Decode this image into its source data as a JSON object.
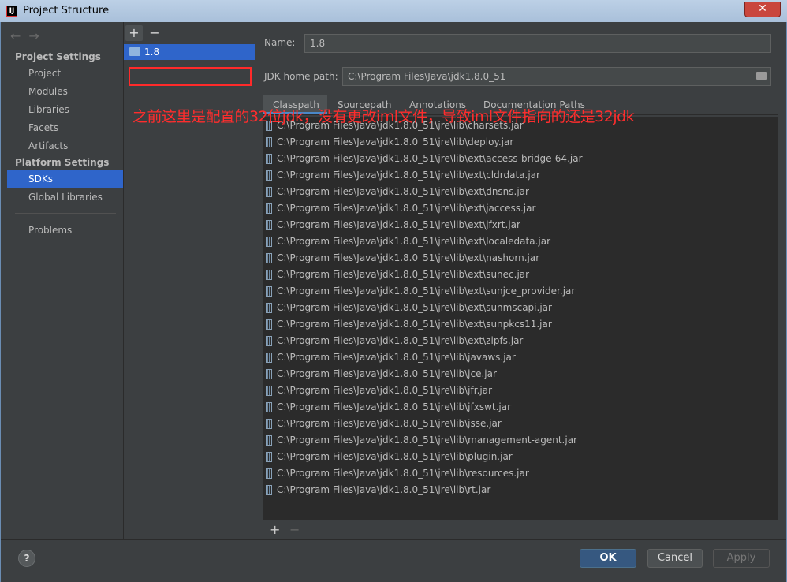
{
  "window": {
    "title": "Project Structure",
    "close_glyph": "✕",
    "app_icon_glyph": "IJ"
  },
  "nav": {
    "back_glyph": "←",
    "forward_glyph": "→",
    "project_settings_header": "Project Settings",
    "project_items": [
      "Project",
      "Modules",
      "Libraries",
      "Facets",
      "Artifacts"
    ],
    "platform_settings_header": "Platform Settings",
    "platform_items": [
      "SDKs",
      "Global Libraries"
    ],
    "problems": "Problems",
    "selected": "SDKs"
  },
  "sdk_list": {
    "add_glyph": "+",
    "remove_glyph": "−",
    "items": [
      "1.8"
    ]
  },
  "form": {
    "name_label": "Name:",
    "name_value": "1.8",
    "home_label": "JDK home path:",
    "home_value": "C:\\Program Files\\Java\\jdk1.8.0_51"
  },
  "tabs": [
    "Classpath",
    "Sourcepath",
    "Annotations",
    "Documentation Paths"
  ],
  "selected_tab": "Classpath",
  "annotation": "之前这里是配置的32位jdk，没有更改iml文件，导致iml文件指向的还是32jdk",
  "classpath": [
    "C:\\Program Files\\Java\\jdk1.8.0_51\\jre\\lib\\charsets.jar",
    "C:\\Program Files\\Java\\jdk1.8.0_51\\jre\\lib\\deploy.jar",
    "C:\\Program Files\\Java\\jdk1.8.0_51\\jre\\lib\\ext\\access-bridge-64.jar",
    "C:\\Program Files\\Java\\jdk1.8.0_51\\jre\\lib\\ext\\cldrdata.jar",
    "C:\\Program Files\\Java\\jdk1.8.0_51\\jre\\lib\\ext\\dnsns.jar",
    "C:\\Program Files\\Java\\jdk1.8.0_51\\jre\\lib\\ext\\jaccess.jar",
    "C:\\Program Files\\Java\\jdk1.8.0_51\\jre\\lib\\ext\\jfxrt.jar",
    "C:\\Program Files\\Java\\jdk1.8.0_51\\jre\\lib\\ext\\localedata.jar",
    "C:\\Program Files\\Java\\jdk1.8.0_51\\jre\\lib\\ext\\nashorn.jar",
    "C:\\Program Files\\Java\\jdk1.8.0_51\\jre\\lib\\ext\\sunec.jar",
    "C:\\Program Files\\Java\\jdk1.8.0_51\\jre\\lib\\ext\\sunjce_provider.jar",
    "C:\\Program Files\\Java\\jdk1.8.0_51\\jre\\lib\\ext\\sunmscapi.jar",
    "C:\\Program Files\\Java\\jdk1.8.0_51\\jre\\lib\\ext\\sunpkcs11.jar",
    "C:\\Program Files\\Java\\jdk1.8.0_51\\jre\\lib\\ext\\zipfs.jar",
    "C:\\Program Files\\Java\\jdk1.8.0_51\\jre\\lib\\javaws.jar",
    "C:\\Program Files\\Java\\jdk1.8.0_51\\jre\\lib\\jce.jar",
    "C:\\Program Files\\Java\\jdk1.8.0_51\\jre\\lib\\jfr.jar",
    "C:\\Program Files\\Java\\jdk1.8.0_51\\jre\\lib\\jfxswt.jar",
    "C:\\Program Files\\Java\\jdk1.8.0_51\\jre\\lib\\jsse.jar",
    "C:\\Program Files\\Java\\jdk1.8.0_51\\jre\\lib\\management-agent.jar",
    "C:\\Program Files\\Java\\jdk1.8.0_51\\jre\\lib\\plugin.jar",
    "C:\\Program Files\\Java\\jdk1.8.0_51\\jre\\lib\\resources.jar",
    "C:\\Program Files\\Java\\jdk1.8.0_51\\jre\\lib\\rt.jar"
  ],
  "classpath_tools": {
    "add_glyph": "+",
    "remove_glyph": "−"
  },
  "footer": {
    "help_glyph": "?",
    "ok": "OK",
    "cancel": "Cancel",
    "apply": "Apply"
  },
  "colors": {
    "selection": "#2f65ca",
    "annotation": "#ff2d2d",
    "ok_button": "#365880"
  }
}
